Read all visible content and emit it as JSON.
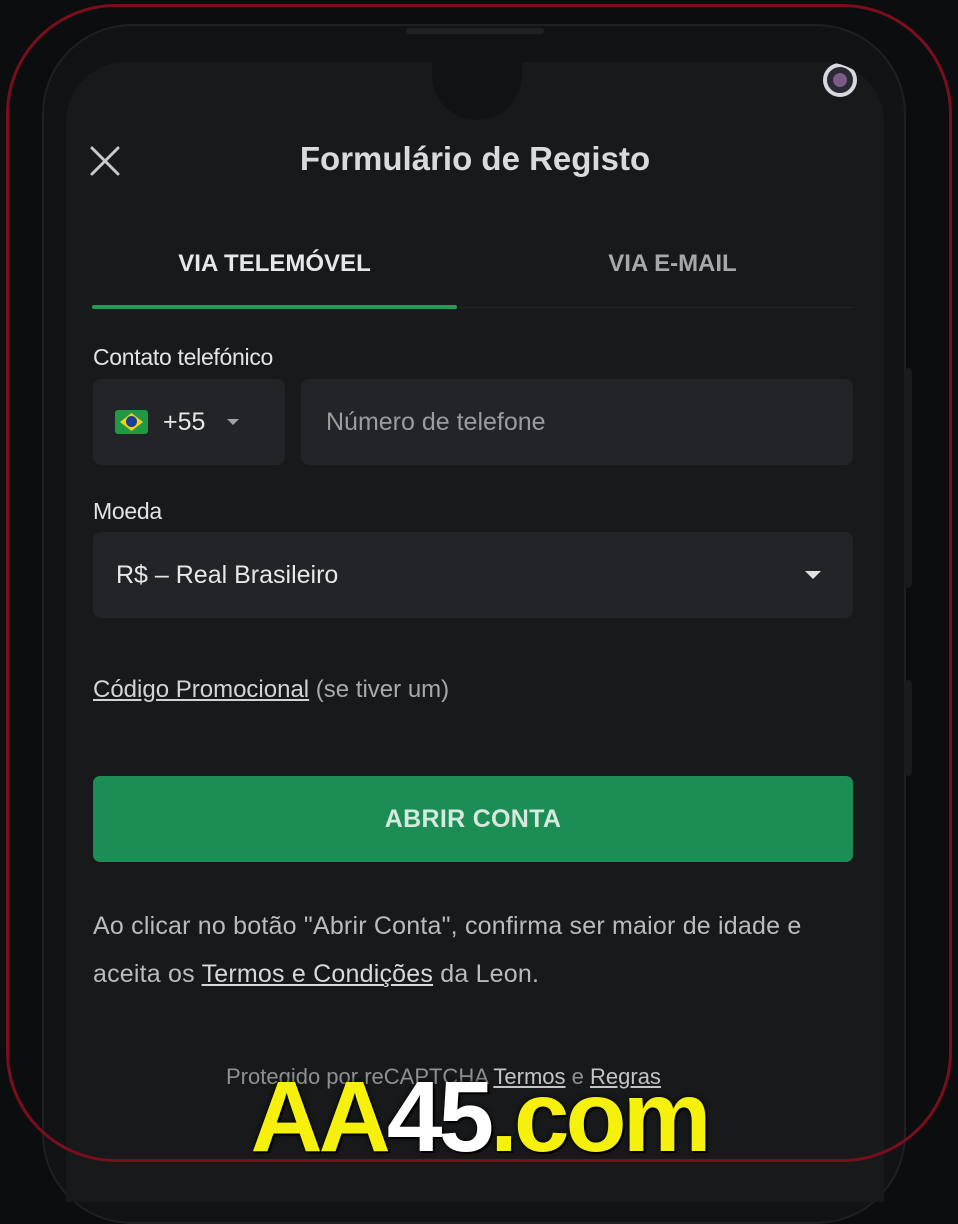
{
  "header": {
    "title": "Formulário de Registo",
    "close_icon": "close-icon"
  },
  "tabs": [
    {
      "label": "VIA TELEMÓVEL",
      "active": true
    },
    {
      "label": "VIA E-MAIL",
      "active": false
    }
  ],
  "phone": {
    "label": "Contato telefónico",
    "country_flag": "brazil-flag-icon",
    "dial_code": "+55",
    "placeholder": "Número de telefone",
    "value": ""
  },
  "currency": {
    "label": "Moeda",
    "selected": "R$ – Real Brasileiro"
  },
  "promo": {
    "link": "Código Promocional",
    "suffix": "(se tiver um)"
  },
  "submit": {
    "label": "ABRIR CONTA"
  },
  "disclaimer": {
    "before": "Ao clicar no botão \"Abrir Conta\", confirma ser maior de idade e aceita os",
    "link": "Termos e Condições",
    "after": "da Leon."
  },
  "recaptcha": {
    "prefix": "Protegido por reCAPTCHA",
    "terms": "Termos",
    "and": "e",
    "rules": "Regras"
  },
  "watermark": {
    "part1": "AA",
    "part2": "45",
    "part3": ".com"
  },
  "colors": {
    "accent": "#1c8d55",
    "tab_underline": "#1f9e5a",
    "frame": "#7a0e1c",
    "watermark_yellow": "#f5f10a"
  }
}
